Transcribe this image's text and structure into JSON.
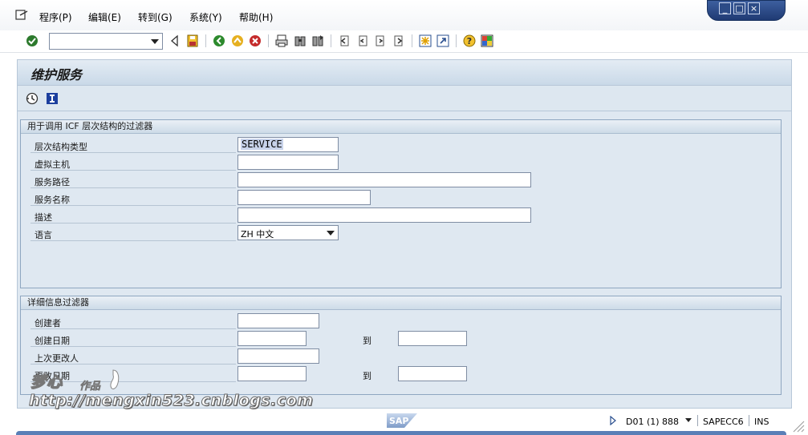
{
  "menu": {
    "items": [
      {
        "label": "程序(P)"
      },
      {
        "label": "编辑(E)"
      },
      {
        "label": "转到(G)"
      },
      {
        "label": "系统(Y)"
      },
      {
        "label": "帮助(H)"
      }
    ]
  },
  "window": {
    "minimize": "_",
    "restore": "□",
    "close": "×"
  },
  "toolbar": {
    "command_value": "",
    "icons": [
      "enter-check-icon",
      "back-triangle-icon",
      "save-icon",
      "back-icon",
      "exit-icon",
      "cancel-icon",
      "print-icon",
      "find-icon",
      "find-next-icon",
      "first-page-icon",
      "previous-page-icon",
      "next-page-icon",
      "last-page-icon",
      "create-session-icon",
      "shortcut-icon",
      "help-icon",
      "customize-icon"
    ]
  },
  "page": {
    "title": "维护服务"
  },
  "app_toolbar": {
    "icons": [
      "execute-icon",
      "information-icon"
    ]
  },
  "icf_filter": {
    "title": "用于调用 ICF 层次结构的过滤器",
    "fields": [
      {
        "label": "层次结构类型",
        "value": "SERVICE"
      },
      {
        "label": "虚拟主机",
        "value": ""
      },
      {
        "label": "服务路径",
        "value": ""
      },
      {
        "label": "服务名称",
        "value": ""
      },
      {
        "label": "描述",
        "value": ""
      },
      {
        "label": "语言",
        "value": "ZH 中文"
      }
    ]
  },
  "detail_filter": {
    "title": "详细信息过滤器",
    "to_label": "到",
    "fields": [
      {
        "label": "创建者",
        "value": ""
      },
      {
        "label": "创建日期",
        "value": "",
        "to_value": ""
      },
      {
        "label": "上次更改人",
        "value": ""
      },
      {
        "label": "更改日期",
        "value": "",
        "to_value": ""
      }
    ]
  },
  "status": {
    "system": "D01 (1) 888",
    "server": "SAPECC6",
    "mode": "INS"
  },
  "watermark": {
    "line1": "梦心",
    "line1_suffix": "作品",
    "line2": "http://mengxin523.cnblogs.com"
  },
  "colors": {
    "frame_blue": "#1f3a73",
    "panel_bg": "#dfe8f1",
    "group_border": "#8ea6c0"
  }
}
